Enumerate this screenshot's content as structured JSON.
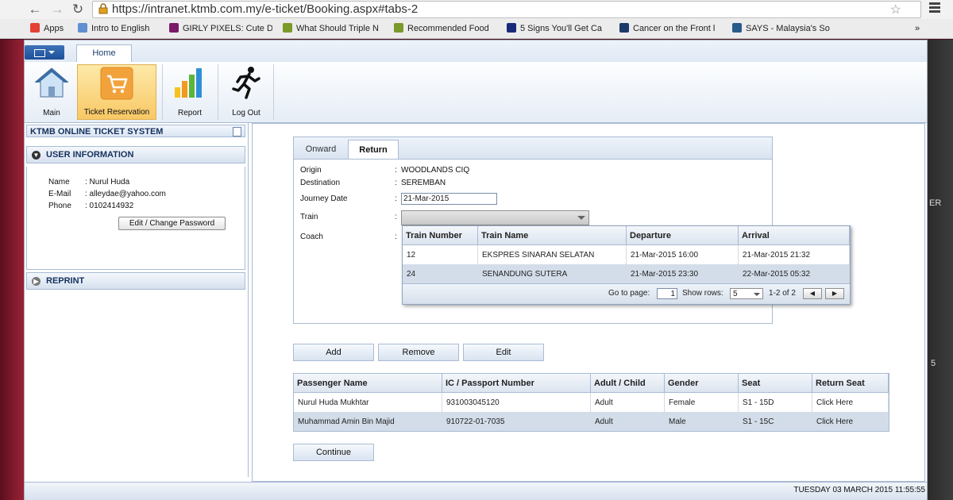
{
  "browser": {
    "url": "https://intranet.ktmb.com.my/e-ticket/Booking.aspx#tabs-2",
    "bookmarks": [
      {
        "label": "Apps",
        "color": "#e34234"
      },
      {
        "label": "Intro to English",
        "color": "#5f8fd1"
      },
      {
        "label": "GIRLY PIXELS: Cute D",
        "color": "#7b1a6a"
      },
      {
        "label": "What Should Triple N",
        "color": "#7a9a2a"
      },
      {
        "label": "Recommended Food",
        "color": "#7a9a2a"
      },
      {
        "label": "5 Signs You'll Get Ca",
        "color": "#1a2a7a"
      },
      {
        "label": "Cancer on the Front l",
        "color": "#1a3a6a"
      },
      {
        "label": "SAYS - Malaysia's So",
        "color": "#2a5a8a"
      }
    ],
    "more": "»"
  },
  "ribbon": {
    "tab_home": "Home",
    "buttons": [
      {
        "label": "Main"
      },
      {
        "label": "Ticket Reservation"
      },
      {
        "label": "Report"
      },
      {
        "label": "Log Out"
      }
    ]
  },
  "leftpanel": {
    "title": "KTMB ONLINE TICKET SYSTEM",
    "user_info_header": "USER INFORMATION",
    "name_label": "Name",
    "name_value": ": Nurul Huda",
    "email_label": "E-Mail",
    "email_value": ": alleydae@yahoo.com",
    "phone_label": "Phone",
    "phone_value": ": 0102414932",
    "change_password": "Edit / Change Password",
    "reprint_header": "REPRINT"
  },
  "booking": {
    "tabs": [
      "Onward",
      "Return"
    ],
    "active_tab": "Return",
    "origin_label": "Origin",
    "origin_value": "WOODLANDS CIQ",
    "destination_label": "Destination",
    "destination_value": "SEREMBAN",
    "journey_date_label": "Journey Date",
    "journey_date_value": "21-Mar-2015",
    "train_label": "Train",
    "coach_label": "Coach",
    "colon": ":",
    "train_grid": {
      "columns": [
        "Train Number",
        "Train Name",
        "Departure",
        "Arrival"
      ],
      "rows": [
        [
          "12",
          "EKSPRES SINARAN SELATAN",
          "21-Mar-2015 16:00",
          "21-Mar-2015 21:32"
        ],
        [
          "24",
          "SENANDUNG SUTERA",
          "21-Mar-2015 23:30",
          "22-Mar-2015 05:32"
        ]
      ],
      "goto_label": "Go to page:",
      "goto_value": "1",
      "show_rows_label": "Show rows:",
      "show_rows_value": "5",
      "range": "1-2 of 2"
    }
  },
  "actions": {
    "add": "Add",
    "remove": "Remove",
    "edit": "Edit",
    "continue": "Continue"
  },
  "passengers": {
    "columns": [
      "Passenger Name",
      "IC / Passport Number",
      "Adult / Child",
      "Gender",
      "Seat",
      "Return Seat"
    ],
    "rows": [
      [
        "Nurul Huda Mukhtar",
        "931003045120",
        "Adult",
        "Female",
        "S1 - 15D",
        "Click Here"
      ],
      [
        "Muhammad Amin Bin Majid",
        "910722-01-7035",
        "Adult",
        "Male",
        "S1 - 15C",
        "Click Here"
      ]
    ]
  },
  "status": {
    "datetime": "TUESDAY 03 MARCH 2015 11:55:55"
  },
  "desktop_right": [
    "ER",
    "5"
  ]
}
